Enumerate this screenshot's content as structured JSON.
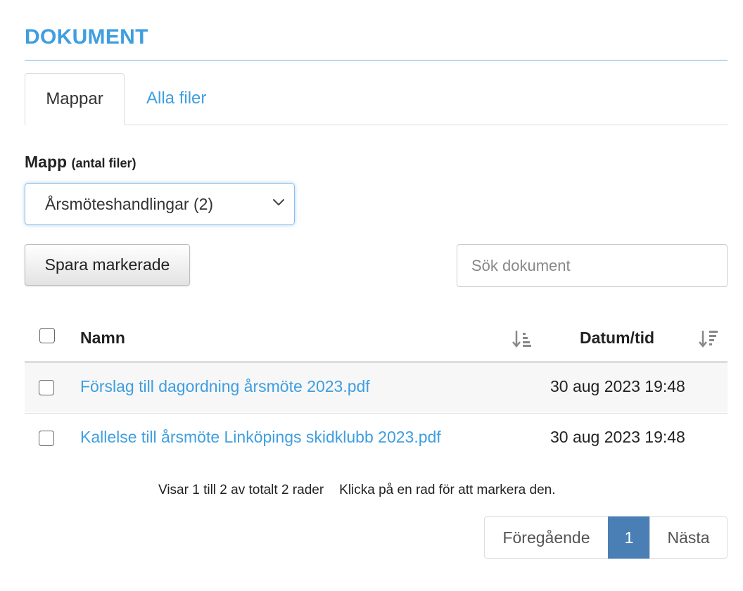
{
  "header": {
    "title": "DOKUMENT"
  },
  "tabs": [
    {
      "label": "Mappar",
      "active": true
    },
    {
      "label": "Alla filer",
      "active": false
    }
  ],
  "folder": {
    "label": "Mapp",
    "label_hint": "(antal filer)",
    "selected": "Årsmöteshandlingar (2)"
  },
  "toolbar": {
    "save_label": "Spara markerade",
    "search_placeholder": "Sök dokument"
  },
  "table": {
    "columns": {
      "name": "Namn",
      "date": "Datum/tid"
    },
    "rows": [
      {
        "name": "Förslag till dagordning årsmöte 2023.pdf",
        "date": "30 aug 2023 19:48"
      },
      {
        "name": "Kallelse till årsmöte Linköpings skidklubb 2023.pdf",
        "date": "30 aug 2023 19:48"
      }
    ]
  },
  "footer": {
    "info": "Visar 1 till 2 av totalt 2 rader",
    "hint": "Klicka på en rad för att markera den."
  },
  "pagination": {
    "prev": "Föregående",
    "current": "1",
    "next": "Nästa"
  },
  "colors": {
    "accent": "#3e9ee0",
    "pager_active": "#4a7fb6"
  }
}
